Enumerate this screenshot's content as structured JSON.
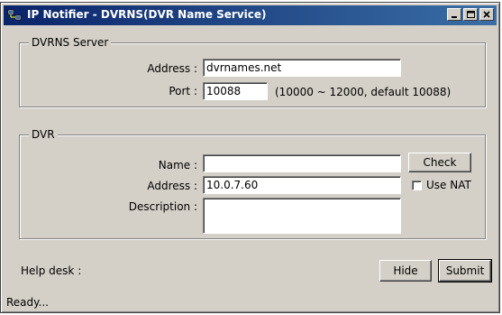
{
  "window": {
    "title": "IP Notifier - DVRNS(DVR Name Service)"
  },
  "dvrns_server": {
    "legend": "DVRNS Server",
    "address_label": "Address :",
    "address_value": "dvrnames.net",
    "port_label": "Port :",
    "port_value": "10088",
    "port_hint": "(10000 ~ 12000, default 10088)"
  },
  "dvr": {
    "legend": "DVR",
    "name_label": "Name :",
    "name_value": "",
    "address_label": "Address :",
    "address_value": "10.0.7.60",
    "description_label": "Description :",
    "description_value": "",
    "check_label": "Check",
    "use_nat_label": "Use NAT",
    "use_nat_checked": false
  },
  "footer": {
    "help_desk_label": "Help desk :",
    "hide_label": "Hide",
    "submit_label": "Submit",
    "status_text": "Ready..."
  },
  "colors": {
    "title_start": "#0a246a",
    "title_end": "#3a6ea5",
    "face": "#d4d0c8"
  }
}
